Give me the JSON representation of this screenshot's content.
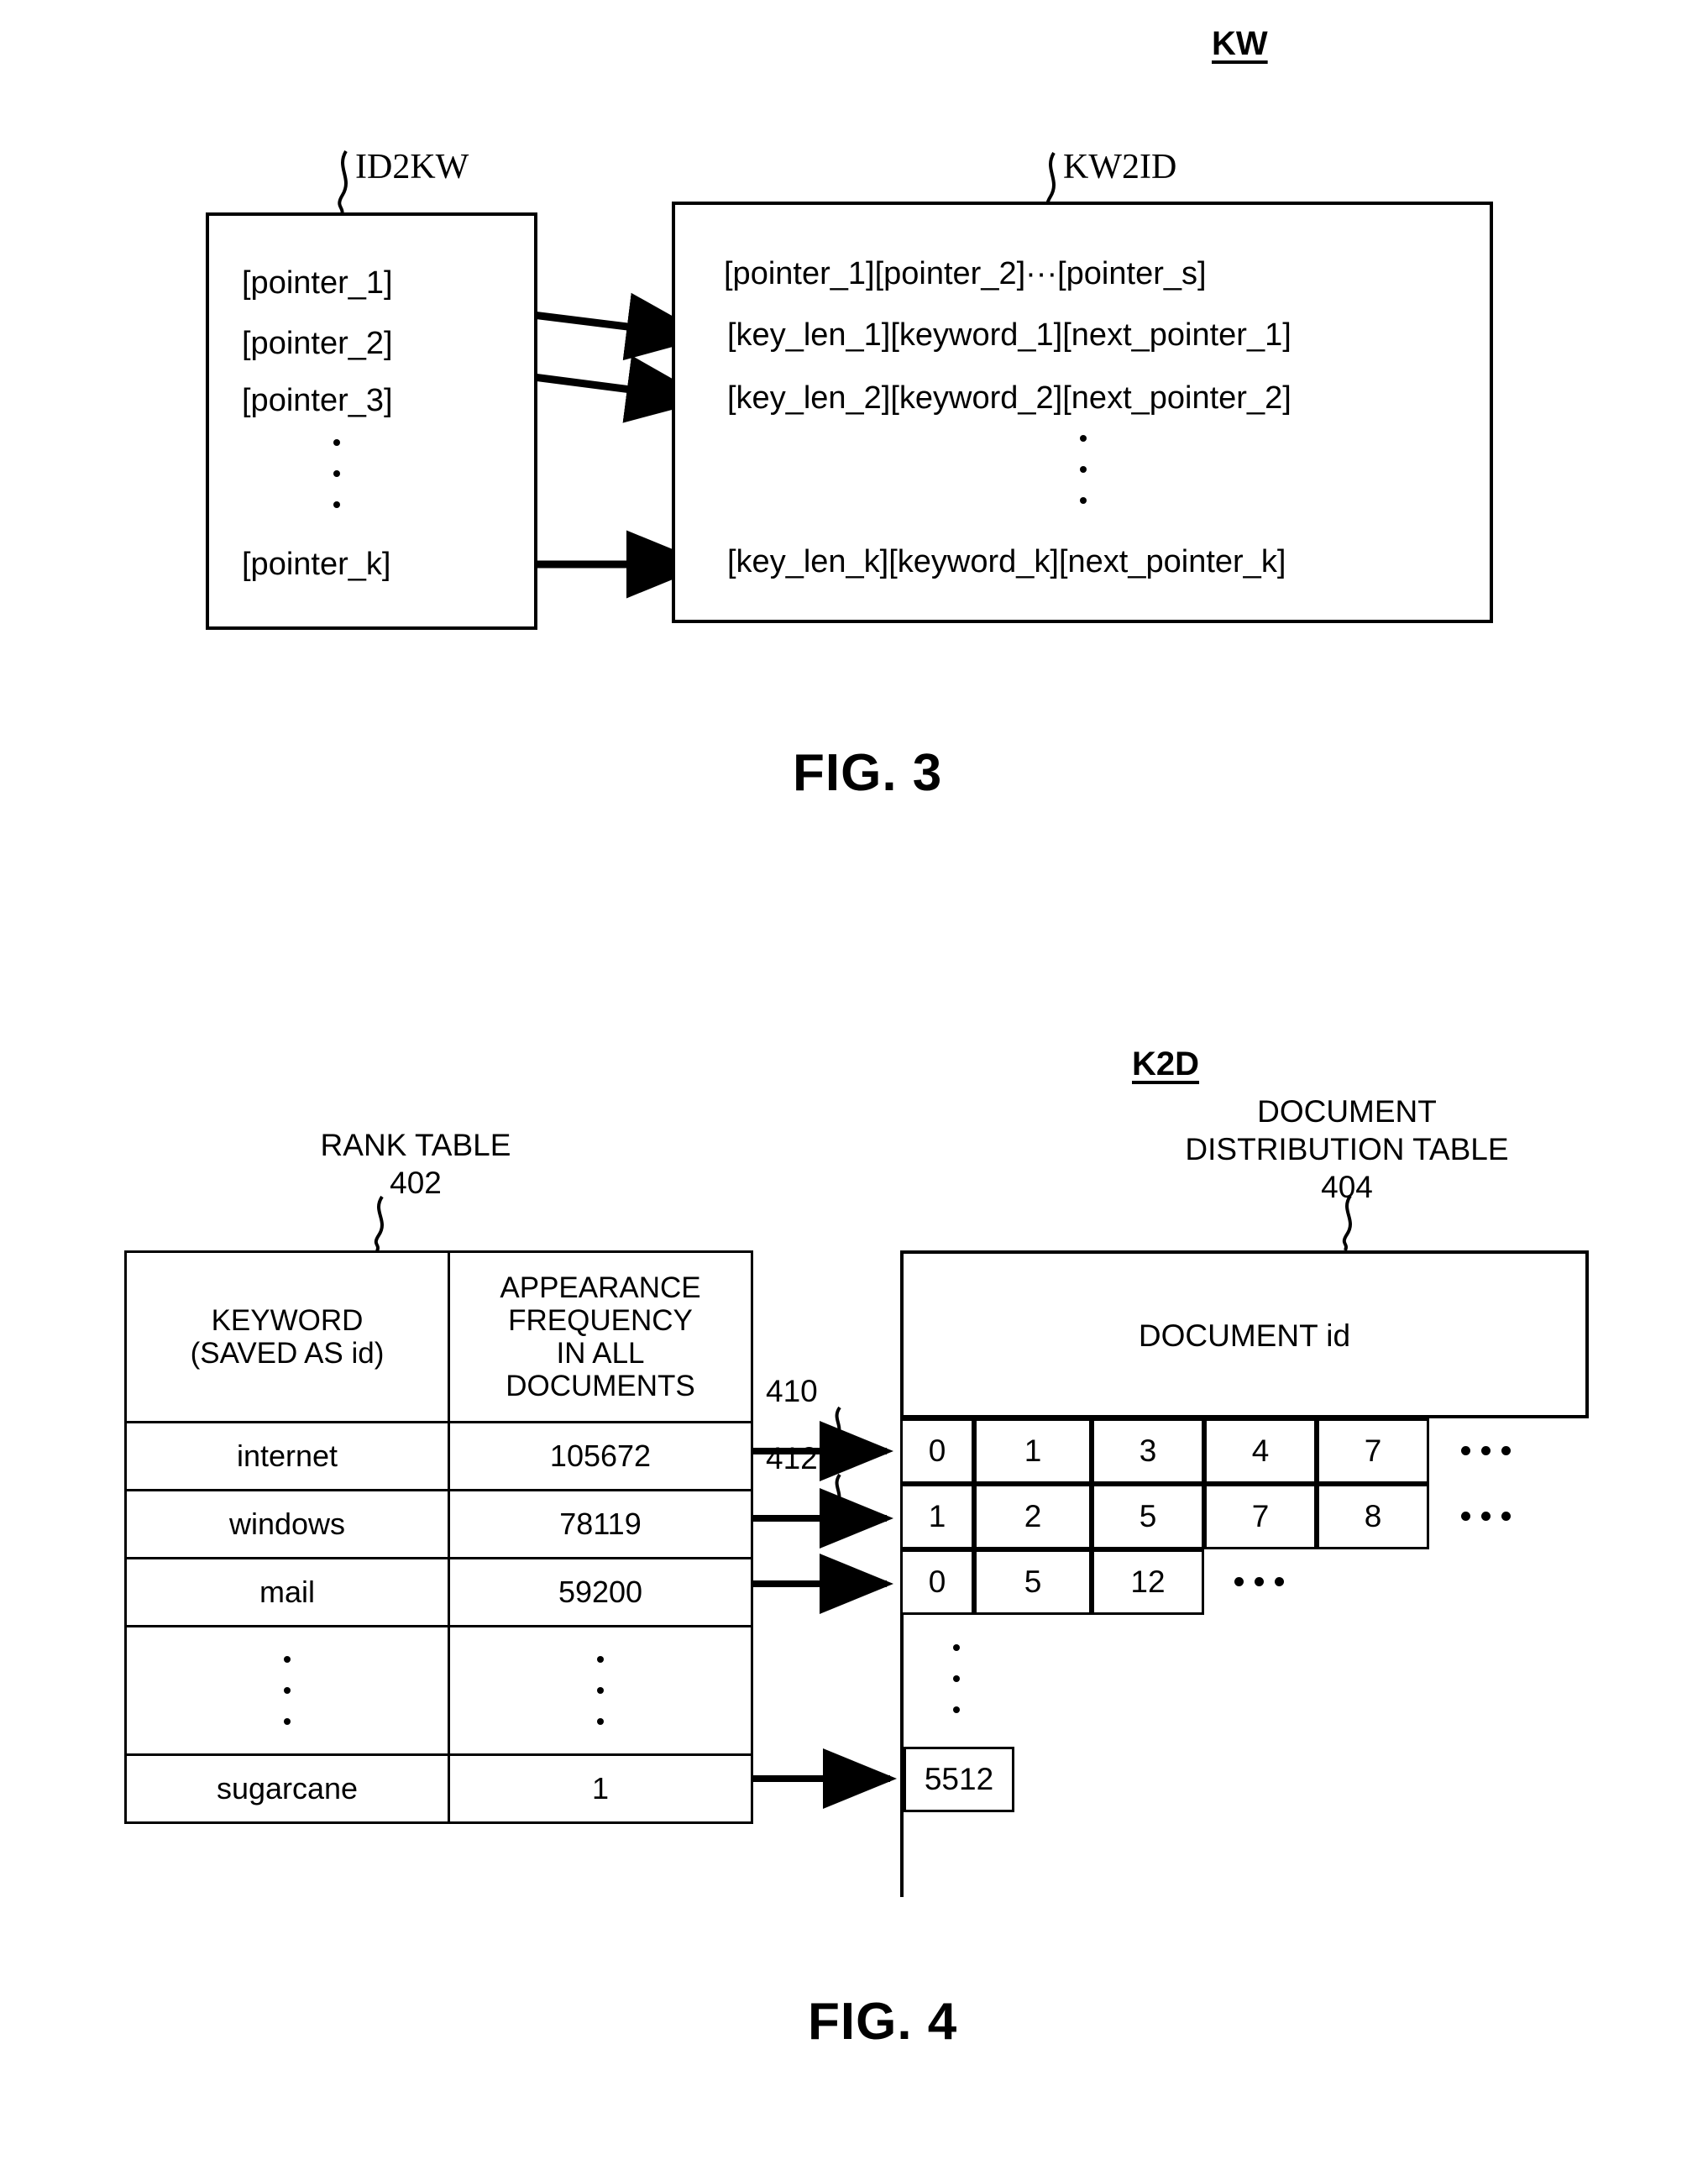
{
  "figure3": {
    "group_tag": "KW",
    "left_table": {
      "tag": "ID2KW",
      "rows": [
        "[pointer_1]",
        "[pointer_2]",
        "[pointer_3]",
        "[pointer_k]"
      ]
    },
    "right_table": {
      "tag": "KW2ID",
      "header_row": "[pointer_1][pointer_2]···[pointer_s]",
      "rows": [
        "[key_len_1][keyword_1][next_pointer_1]",
        "[key_len_2][keyword_2][next_pointer_2]",
        "[key_len_k][keyword_k][next_pointer_k]"
      ]
    },
    "caption": "FIG. 3"
  },
  "figure4": {
    "group_tag": "K2D",
    "rank_table": {
      "title": "RANK TABLE",
      "ref": "402",
      "headers": [
        "KEYWORD\n(SAVED AS id)",
        "APPEARANCE\nFREQUENCY\nIN ALL\nDOCUMENTS"
      ],
      "header_keyword_line1": "KEYWORD",
      "header_keyword_line2": "(SAVED AS id)",
      "header_freq_line1": "APPEARANCE",
      "header_freq_line2": "FREQUENCY",
      "header_freq_line3": "IN ALL",
      "header_freq_line4": "DOCUMENTS",
      "rows": [
        {
          "keyword": "internet",
          "frequency": "105672"
        },
        {
          "keyword": "windows",
          "frequency": "78119"
        },
        {
          "keyword": "mail",
          "frequency": "59200"
        },
        {
          "keyword": "",
          "frequency": ""
        },
        {
          "keyword": "sugarcane",
          "frequency": "1"
        }
      ]
    },
    "distribution_table": {
      "title_line1": "DOCUMENT",
      "title_line2": "DISTRIBUTION TABLE",
      "ref": "404",
      "header": "DOCUMENT id",
      "rows": [
        {
          "cells": [
            "0",
            "1",
            "3",
            "4",
            "7"
          ],
          "trailing_ellipsis": true
        },
        {
          "cells": [
            "1",
            "2",
            "5",
            "7",
            "8"
          ],
          "trailing_ellipsis": true
        },
        {
          "cells": [
            "0",
            "5",
            "12"
          ],
          "trailing_ellipsis": true
        },
        {
          "cells": [
            "5512"
          ],
          "trailing_ellipsis": false
        }
      ]
    },
    "arrow_refs": [
      "410",
      "412"
    ],
    "caption": "FIG. 4"
  },
  "colors": {
    "ink": "#000000",
    "paper": "#ffffff"
  }
}
